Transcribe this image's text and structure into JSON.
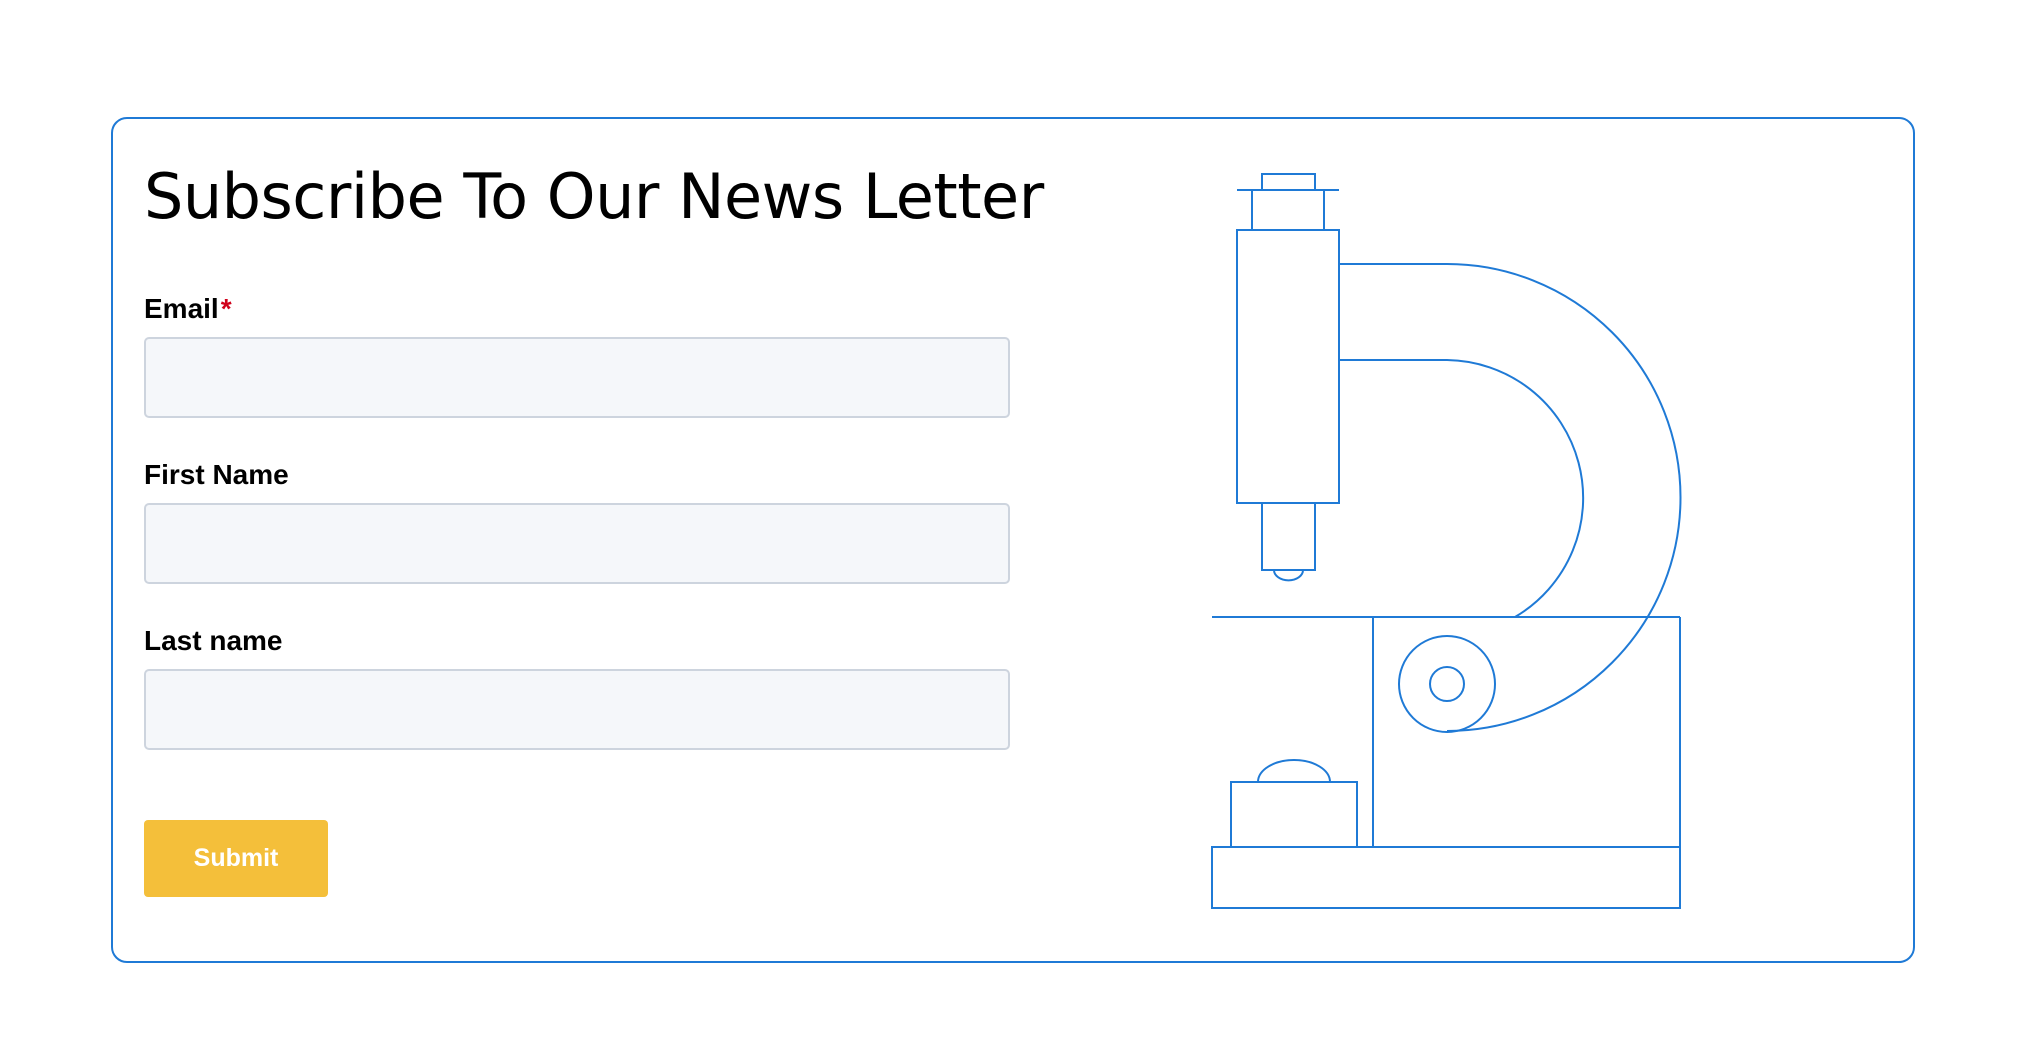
{
  "form": {
    "title": "Subscribe To Our News Letter",
    "fields": [
      {
        "label": "Email",
        "required": true,
        "required_mark": "*",
        "value": "",
        "placeholder": ""
      },
      {
        "label": "First Name",
        "required": false,
        "value": "",
        "placeholder": ""
      },
      {
        "label": "Last name",
        "required": false,
        "value": "",
        "placeholder": ""
      }
    ],
    "submit_label": "Submit"
  },
  "illustration": {
    "icon": "microscope-icon"
  },
  "colors": {
    "accent_border": "#1f7ad6",
    "button_bg": "#f4bf3a",
    "button_text": "#ffffff",
    "input_bg": "#f5f7fa",
    "input_border": "#cdd4de",
    "required_mark": "#d0021b"
  }
}
